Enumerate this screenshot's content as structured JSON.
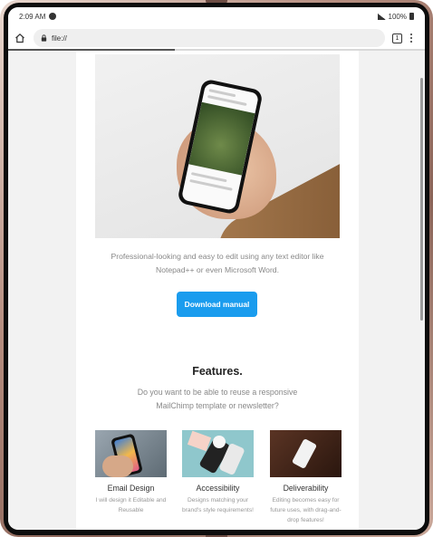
{
  "status_bar": {
    "time": "2:09 AM",
    "battery": "100%"
  },
  "browser": {
    "url": "file://",
    "tab_count": "1",
    "load_progress": 0.4
  },
  "content": {
    "description": "Professional-looking and easy to edit using any text editor like Notepad++ or even Microsoft Word.",
    "download_label": "Download manual",
    "features_title": "Features.",
    "features_subtitle": "Do you want to be able to reuse a responsive MailChimp template or newsletter?",
    "features": [
      {
        "title": "Email Design",
        "text": "I will design it Editable and Reusable"
      },
      {
        "title": "Accessibility",
        "text": "Designs matching your brand's style requirements!"
      },
      {
        "title": "Deliverability",
        "text": "Editing becomes easy for future uses, with drag-and-drop features!"
      }
    ]
  },
  "colors": {
    "accent": "#1a9cee",
    "frame": "#b58d7f"
  }
}
